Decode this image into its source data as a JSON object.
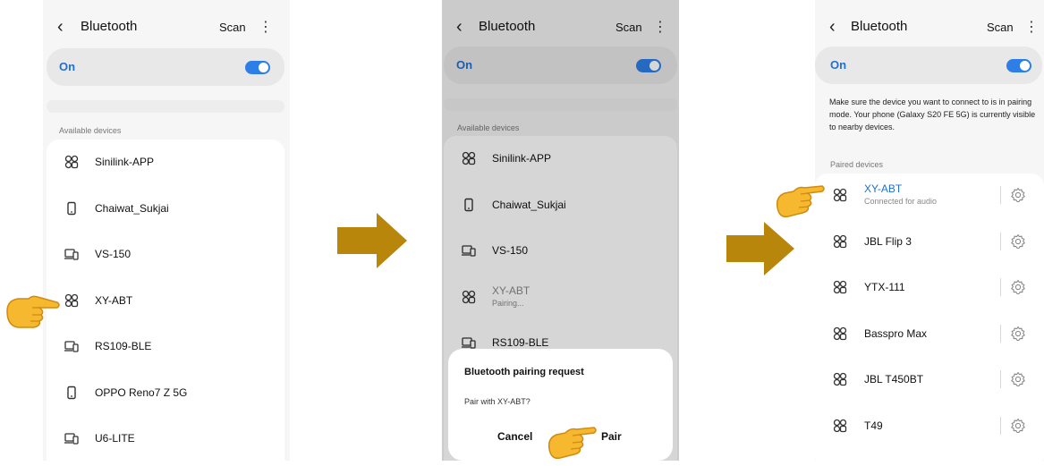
{
  "screen1": {
    "title": "Bluetooth",
    "scan": "Scan",
    "toggle_label": "On",
    "section": "Available devices",
    "devices": [
      {
        "name": "Sinilink-APP",
        "icon": "other-device-icon"
      },
      {
        "name": "Chaiwat_Sukjai",
        "icon": "phone-icon"
      },
      {
        "name": "VS-150",
        "icon": "computer-icon"
      },
      {
        "name": "XY-ABT",
        "icon": "other-device-icon"
      },
      {
        "name": "RS109-BLE",
        "icon": "computer-icon"
      },
      {
        "name": "OPPO Reno7 Z 5G",
        "icon": "phone-icon"
      },
      {
        "name": "U6-LITE",
        "icon": "computer-icon"
      }
    ]
  },
  "screen2": {
    "title": "Bluetooth",
    "scan": "Scan",
    "toggle_label": "On",
    "section": "Available devices",
    "devices": [
      {
        "name": "Sinilink-APP",
        "icon": "other-device-icon"
      },
      {
        "name": "Chaiwat_Sukjai",
        "icon": "phone-icon"
      },
      {
        "name": "VS-150",
        "icon": "computer-icon"
      },
      {
        "name": "XY-ABT",
        "status": "Pairing...",
        "icon": "other-device-icon"
      },
      {
        "name": "RS109-BLE",
        "icon": "computer-icon"
      }
    ],
    "dialog": {
      "title": "Bluetooth pairing request",
      "message": "Pair with XY-ABT?",
      "cancel": "Cancel",
      "pair": "Pair"
    }
  },
  "screen3": {
    "title": "Bluetooth",
    "scan": "Scan",
    "toggle_label": "On",
    "note": "Make sure the device you want to connect to is in pairing mode. Your phone (Galaxy S20 FE 5G) is currently visible to nearby devices.",
    "section": "Paired devices",
    "devices": [
      {
        "name": "XY-ABT",
        "status": "Connected for audio",
        "icon": "other-device-icon"
      },
      {
        "name": "JBL Flip 3",
        "icon": "other-device-icon"
      },
      {
        "name": "YTX-111",
        "icon": "other-device-icon"
      },
      {
        "name": "Basspro Max",
        "icon": "other-device-icon"
      },
      {
        "name": "JBL T450BT",
        "icon": "other-device-icon"
      },
      {
        "name": "T49",
        "icon": "other-device-icon"
      }
    ]
  },
  "colors": {
    "accent": "#1f6fd4",
    "arrow": "#b8860b",
    "hand": "#f5b82e",
    "dim": "rgba(0,0,0,0.16)"
  }
}
